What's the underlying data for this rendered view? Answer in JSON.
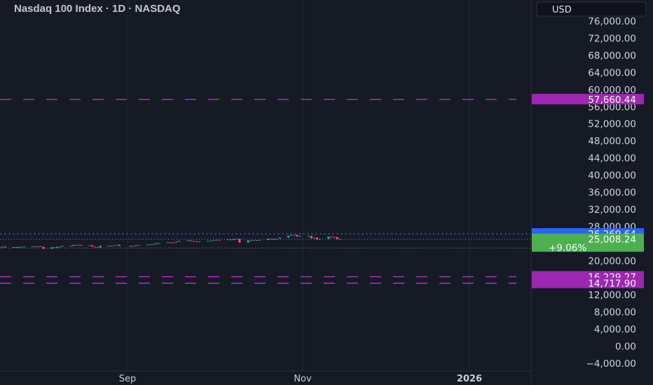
{
  "header": {
    "title": "Nasdaq 100 Index · 1D · NASDAQ",
    "currency_button": "USD"
  },
  "colors": {
    "background": "#161a25",
    "grid": "#232735",
    "up": "#26a69a",
    "down": "#ef5350",
    "level_line": "#b53cc9",
    "level_badge": "#9c27b0",
    "last_price_badge": "#4caf50",
    "high_badge": "#2962ff"
  },
  "chart_data": {
    "type": "candlestick",
    "title": "Nasdaq 100 Index · 1D · NASDAQ",
    "y_axis": {
      "ticks": [
        "76,000.00",
        "72,000.00",
        "68,000.00",
        "64,000.00",
        "60,000.00",
        "56,000.00",
        "52,000.00",
        "48,000.00",
        "44,000.00",
        "40,000.00",
        "36,000.00",
        "32,000.00",
        "28,000.00",
        "24,000.00",
        "20,000.00",
        "16,000.00",
        "12,000.00",
        "8,000.00",
        "4,000.00",
        "0.00",
        "−4,000.00"
      ],
      "range": [
        -4000,
        76000
      ]
    },
    "x_axis": {
      "ticks": [
        {
          "label": "Sep",
          "bold": false
        },
        {
          "label": "Nov",
          "bold": false
        },
        {
          "label": "2026",
          "bold": true
        }
      ]
    },
    "horizontal_levels": [
      {
        "value": 57660.44,
        "label": "57,660.44"
      },
      {
        "value": 16229.27,
        "label": "16,229.27"
      },
      {
        "value": 14717.9,
        "label": "14,717.90"
      }
    ],
    "last_price": {
      "value": 25008.24,
      "label": "25,008.24",
      "change": "+9.06%"
    },
    "high_line": {
      "value": 26269.64,
      "label": "26,269.64"
    },
    "range_start_line": {
      "value": 22930
    },
    "series": [
      {
        "date": "2025-07-16",
        "open": 23000,
        "close": 23090
      },
      {
        "date": "2025-07-17",
        "open": 23090,
        "close": 23280
      },
      {
        "date": "2025-07-18",
        "open": 23280,
        "close": 23060
      },
      {
        "date": "2025-07-21",
        "open": 23060,
        "close": 23150
      },
      {
        "date": "2025-07-22",
        "open": 23150,
        "close": 23000
      },
      {
        "date": "2025-07-23",
        "open": 23000,
        "close": 23220
      },
      {
        "date": "2025-07-24",
        "open": 23220,
        "close": 23230
      },
      {
        "date": "2025-07-25",
        "open": 23230,
        "close": 23270
      },
      {
        "date": "2025-07-28",
        "open": 23270,
        "close": 23330
      },
      {
        "date": "2025-07-29",
        "open": 23330,
        "close": 23300
      },
      {
        "date": "2025-07-30",
        "open": 23300,
        "close": 23360
      },
      {
        "date": "2025-07-31",
        "open": 23360,
        "close": 23220
      },
      {
        "date": "2025-08-01",
        "open": 23220,
        "close": 22760
      },
      {
        "date": "2025-08-04",
        "open": 22760,
        "close": 23120
      },
      {
        "date": "2025-08-05",
        "open": 23120,
        "close": 22960
      },
      {
        "date": "2025-08-06",
        "open": 22960,
        "close": 23200
      },
      {
        "date": "2025-08-07",
        "open": 23200,
        "close": 23280
      },
      {
        "date": "2025-08-08",
        "open": 23280,
        "close": 23470
      },
      {
        "date": "2025-08-11",
        "open": 23470,
        "close": 23410
      },
      {
        "date": "2025-08-12",
        "open": 23410,
        "close": 23640
      },
      {
        "date": "2025-08-13",
        "open": 23640,
        "close": 23690
      },
      {
        "date": "2025-08-14",
        "open": 23690,
        "close": 23670
      },
      {
        "date": "2025-08-15",
        "open": 23670,
        "close": 23600
      },
      {
        "date": "2025-08-18",
        "open": 23600,
        "close": 23600
      },
      {
        "date": "2025-08-19",
        "open": 23600,
        "close": 23280
      },
      {
        "date": "2025-08-20",
        "open": 23280,
        "close": 23150
      },
      {
        "date": "2025-08-21",
        "open": 23150,
        "close": 23060
      },
      {
        "date": "2025-08-22",
        "open": 23060,
        "close": 23480
      },
      {
        "date": "2025-08-25",
        "open": 23480,
        "close": 23390
      },
      {
        "date": "2025-08-26",
        "open": 23390,
        "close": 23470
      },
      {
        "date": "2025-08-27",
        "open": 23470,
        "close": 23560
      },
      {
        "date": "2025-08-28",
        "open": 23560,
        "close": 23700
      },
      {
        "date": "2025-08-29",
        "open": 23700,
        "close": 23420
      },
      {
        "date": "2025-09-02",
        "open": 23420,
        "close": 23230
      },
      {
        "date": "2025-09-03",
        "open": 23230,
        "close": 23410
      },
      {
        "date": "2025-09-04",
        "open": 23410,
        "close": 23620
      },
      {
        "date": "2025-09-05",
        "open": 23620,
        "close": 23650
      },
      {
        "date": "2025-09-08",
        "open": 23650,
        "close": 23760
      },
      {
        "date": "2025-09-09",
        "open": 23760,
        "close": 23840
      },
      {
        "date": "2025-09-10",
        "open": 23840,
        "close": 23850
      },
      {
        "date": "2025-09-11",
        "open": 23850,
        "close": 24090
      },
      {
        "date": "2025-09-12",
        "open": 24090,
        "close": 24090
      },
      {
        "date": "2025-09-15",
        "open": 24090,
        "close": 24270
      },
      {
        "date": "2025-09-16",
        "open": 24270,
        "close": 24250
      },
      {
        "date": "2025-09-17",
        "open": 24250,
        "close": 24230
      },
      {
        "date": "2025-09-18",
        "open": 24230,
        "close": 24450
      },
      {
        "date": "2025-09-19",
        "open": 24450,
        "close": 24630
      },
      {
        "date": "2025-09-22",
        "open": 24630,
        "close": 24760
      },
      {
        "date": "2025-09-23",
        "open": 24760,
        "close": 24580
      },
      {
        "date": "2025-09-24",
        "open": 24580,
        "close": 24500
      },
      {
        "date": "2025-09-25",
        "open": 24500,
        "close": 24390
      },
      {
        "date": "2025-09-26",
        "open": 24390,
        "close": 24500
      },
      {
        "date": "2025-09-29",
        "open": 24500,
        "close": 24610
      },
      {
        "date": "2025-09-30",
        "open": 24610,
        "close": 24680
      },
      {
        "date": "2025-10-01",
        "open": 24680,
        "close": 24790
      },
      {
        "date": "2025-10-02",
        "open": 24790,
        "close": 24840
      },
      {
        "date": "2025-10-03",
        "open": 24840,
        "close": 24780
      },
      {
        "date": "2025-10-06",
        "open": 24780,
        "close": 24950
      },
      {
        "date": "2025-10-07",
        "open": 24950,
        "close": 24780
      },
      {
        "date": "2025-10-08",
        "open": 24780,
        "close": 25040
      },
      {
        "date": "2025-10-09",
        "open": 25040,
        "close": 25100
      },
      {
        "date": "2025-10-10",
        "open": 25100,
        "close": 24220
      },
      {
        "date": "2025-10-13",
        "open": 24220,
        "close": 24740
      },
      {
        "date": "2025-10-14",
        "open": 24740,
        "close": 24640
      },
      {
        "date": "2025-10-15",
        "open": 24640,
        "close": 24800
      },
      {
        "date": "2025-10-16",
        "open": 24800,
        "close": 24710
      },
      {
        "date": "2025-10-17",
        "open": 24710,
        "close": 24820
      },
      {
        "date": "2025-10-20",
        "open": 24820,
        "close": 25120
      },
      {
        "date": "2025-10-21",
        "open": 25120,
        "close": 25110
      },
      {
        "date": "2025-10-22",
        "open": 25110,
        "close": 24880
      },
      {
        "date": "2025-10-23",
        "open": 24880,
        "close": 25100
      },
      {
        "date": "2025-10-24",
        "open": 25100,
        "close": 25360
      },
      {
        "date": "2025-10-27",
        "open": 25360,
        "close": 25820
      },
      {
        "date": "2025-10-28",
        "open": 25820,
        "close": 26010
      },
      {
        "date": "2025-10-29",
        "open": 26010,
        "close": 26010
      },
      {
        "date": "2025-10-30",
        "open": 26010,
        "close": 25610
      },
      {
        "date": "2025-10-31",
        "open": 25610,
        "close": 25730
      },
      {
        "date": "2025-11-03",
        "open": 25730,
        "close": 25790
      },
      {
        "date": "2025-11-04",
        "open": 25790,
        "close": 25240
      },
      {
        "date": "2025-11-05",
        "open": 25240,
        "close": 25380
      },
      {
        "date": "2025-11-06",
        "open": 25380,
        "close": 24920
      },
      {
        "date": "2025-11-07",
        "open": 24920,
        "close": 25060
      },
      {
        "date": "2025-11-10",
        "open": 25060,
        "close": 25620
      },
      {
        "date": "2025-11-11",
        "open": 25620,
        "close": 25530
      },
      {
        "date": "2025-11-12",
        "open": 25530,
        "close": 25520
      },
      {
        "date": "2025-11-13",
        "open": 25520,
        "close": 25010
      },
      {
        "date": "2025-11-14",
        "open": 25010,
        "close": 25010
      }
    ]
  }
}
